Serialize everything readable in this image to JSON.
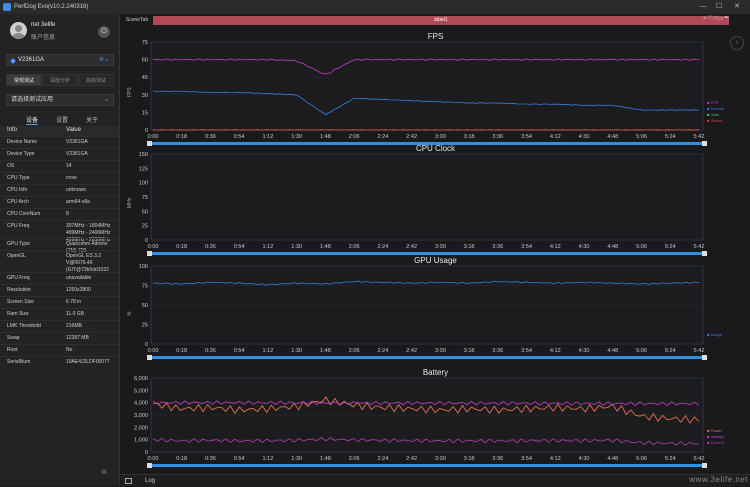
{
  "window": {
    "title": "PerfDog Evo(v10.2.240316)",
    "min": "—",
    "max": "☐",
    "close": "✕"
  },
  "sidebar": {
    "user": {
      "name": "net 3elife",
      "account": "账户信息"
    },
    "device": "V2361GA",
    "mode_tabs": [
      "常规测试",
      "深度分析",
      "高级测试"
    ],
    "app_select": "请选择测试应用",
    "sub_tabs": [
      "设备",
      "设置",
      "关于"
    ],
    "info_header": {
      "key": "Info",
      "value": "Value"
    },
    "info": [
      {
        "k": "Device Name",
        "v": "V2361GA"
      },
      {
        "k": "Device Type",
        "v": "V2361GA"
      },
      {
        "k": "OS",
        "v": "14"
      },
      {
        "k": "CPU Type",
        "v": "crow"
      },
      {
        "k": "CPU Info",
        "v": "unknown"
      },
      {
        "k": "CPU Arch",
        "v": "arm64-v8a"
      },
      {
        "k": "CPU CoreNum",
        "v": "8"
      },
      {
        "k": "CPU Freq",
        "v": "307MHz - 1804MHz\n499MHz - 2400MHz\n499MHz - 2630MHz"
      },
      {
        "k": "GPU Type",
        "v": "Qualcomm Adreno\n(TM) 720"
      },
      {
        "k": "OpenGL",
        "v": "OpenGL ES 3.2\nV@0676.46\n(GIT@73b5dd1032"
      },
      {
        "k": "GPU Freq",
        "v": "unavailable"
      },
      {
        "k": "Resolution",
        "v": "1260x2800"
      },
      {
        "k": "Screen Size",
        "v": "6.78 in"
      },
      {
        "k": "Ram Size",
        "v": "11.0 GB"
      },
      {
        "k": "LMK Threshold",
        "v": "216MB"
      },
      {
        "k": "Swap",
        "v": "12287 MB"
      },
      {
        "k": "Root",
        "v": "No"
      },
      {
        "k": "SerialNum",
        "v": "10AE4J2LDF00077"
      }
    ]
  },
  "main": {
    "scene_tab": "SceneTab",
    "label_bar": "label1",
    "log": "Log",
    "watermark": "www.3elife.net"
  },
  "chart_data": [
    {
      "type": "line",
      "title": "FPS",
      "ylabel": "FPS",
      "ylim": [
        0,
        75
      ],
      "yticks": [
        0,
        15,
        30,
        45,
        60,
        75
      ],
      "xticks": [
        "0:00",
        "0:18",
        "0:36",
        "0:54",
        "1:12",
        "1:30",
        "1:48",
        "2:06",
        "2:24",
        "2:42",
        "3:00",
        "3:18",
        "3:36",
        "3:54",
        "4:12",
        "4:30",
        "4:48",
        "5:06",
        "5:24",
        "5:42"
      ],
      "series": [
        {
          "name": "FPS",
          "color": "#c43fc4",
          "values": [
            60,
            60,
            60,
            60,
            60,
            59,
            47,
            60,
            60,
            60,
            60,
            60,
            60,
            60,
            60,
            60,
            60,
            60,
            60,
            60
          ]
        },
        {
          "name": "Smooth",
          "color": "#3a7de0",
          "values": [
            33,
            33,
            32,
            32,
            31,
            30,
            13,
            27,
            26,
            25,
            24,
            23,
            23,
            22,
            22,
            21,
            21,
            17,
            17,
            17
          ]
        },
        {
          "name": "Jank",
          "color": "#40c070",
          "values": [
            0,
            0,
            0,
            0,
            0,
            0,
            0,
            0,
            0,
            0,
            0,
            0,
            0,
            0,
            0,
            0,
            0,
            0,
            0,
            0
          ]
        },
        {
          "name": "Stutter",
          "color": "#e04040",
          "values": [
            0,
            0,
            0,
            0,
            0,
            0,
            0,
            0,
            0,
            0,
            0,
            0,
            0,
            0,
            0,
            0,
            0,
            0,
            0,
            0
          ]
        }
      ]
    },
    {
      "type": "line",
      "title": "CPU Clock",
      "ylabel": "MHz",
      "ylim": [
        0,
        150
      ],
      "yticks": [
        0,
        25,
        50,
        75,
        100,
        125,
        150
      ],
      "xticks": [
        "0:00",
        "0:18",
        "0:36",
        "0:54",
        "1:12",
        "1:30",
        "1:48",
        "2:06",
        "2:24",
        "2:42",
        "3:00",
        "3:18",
        "3:36",
        "3:54",
        "4:12",
        "4:30",
        "4:48",
        "5:06",
        "5:24",
        "5:42"
      ],
      "series": []
    },
    {
      "type": "line",
      "title": "GPU Usage",
      "ylabel": "%",
      "ylim": [
        0,
        100
      ],
      "yticks": [
        0,
        25,
        50,
        75,
        100
      ],
      "xticks": [
        "0:00",
        "0:18",
        "0:36",
        "0:54",
        "1:12",
        "1:30",
        "1:48",
        "2:06",
        "2:24",
        "2:42",
        "3:00",
        "3:18",
        "3:36",
        "3:54",
        "4:12",
        "4:30",
        "4:48",
        "5:06",
        "5:24",
        "5:42"
      ],
      "series": [
        {
          "name": "Usage",
          "color": "#3a7de0",
          "values": [
            78,
            77,
            79,
            78,
            76,
            78,
            77,
            80,
            79,
            78,
            79,
            78,
            80,
            79,
            78,
            79,
            78,
            77,
            78,
            79
          ]
        }
      ]
    },
    {
      "type": "line",
      "title": "Battery",
      "ylim": [
        0,
        6000
      ],
      "yticks": [
        0,
        1000,
        2000,
        3000,
        4000,
        5000,
        6000
      ],
      "xticks": [
        "0:00",
        "0:18",
        "0:36",
        "0:54",
        "1:12",
        "1:30",
        "1:48",
        "2:06",
        "2:24",
        "2:42",
        "3:00",
        "3:18",
        "3:36",
        "3:54",
        "4:12",
        "4:30",
        "4:48",
        "5:06",
        "5:24",
        "5:42"
      ],
      "series": [
        {
          "name": "Power",
          "color": "#e07050",
          "values": [
            3900,
            3500,
            3600,
            3400,
            3500,
            3700,
            4200,
            3800,
            3600,
            3500,
            3400,
            3500,
            3400,
            3500,
            3600,
            3500,
            3700,
            2900,
            2700,
            2600
          ]
        },
        {
          "name": "Voltage",
          "color": "#c43fc4",
          "values": [
            4000,
            4000,
            4000,
            4000,
            3990,
            3990,
            3980,
            3980,
            3970,
            3970,
            3960,
            3960,
            3950,
            3950,
            3940,
            3940,
            3930,
            3920,
            3920,
            3910
          ]
        },
        {
          "name": "Current",
          "color": "#b040b0",
          "values": [
            1000,
            900,
            950,
            900,
            920,
            950,
            1050,
            980,
            940,
            920,
            900,
            910,
            900,
            920,
            930,
            920,
            950,
            750,
            700,
            680
          ]
        }
      ]
    }
  ]
}
